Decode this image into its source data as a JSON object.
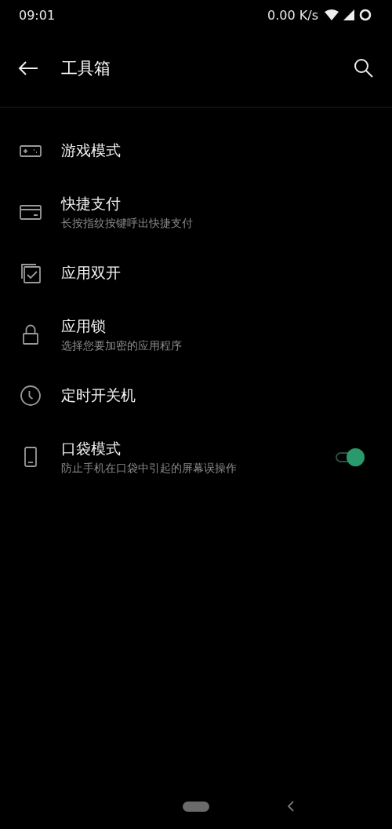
{
  "status_bar": {
    "time": "09:01",
    "net_speed": "0.00 K/s"
  },
  "app_bar": {
    "title": "工具箱"
  },
  "items": [
    {
      "kind": "plain",
      "title": "游戏模式"
    },
    {
      "kind": "plain",
      "title": "快捷支付",
      "subtitle": "长按指纹按键呼出快捷支付"
    },
    {
      "kind": "plain",
      "title": "应用双开"
    },
    {
      "kind": "plain",
      "title": "应用锁",
      "subtitle": "选择您要加密的应用程序"
    },
    {
      "kind": "plain",
      "title": "定时开关机"
    },
    {
      "kind": "toggle",
      "title": "口袋模式",
      "subtitle": "防止手机在口袋中引起的屏幕误操作",
      "on": true
    }
  ]
}
